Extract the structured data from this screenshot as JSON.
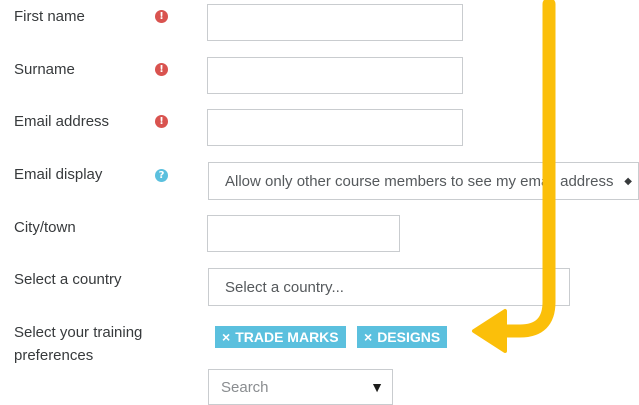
{
  "form": {
    "first_name": {
      "label": "First name",
      "value": ""
    },
    "surname": {
      "label": "Surname",
      "value": ""
    },
    "email": {
      "label": "Email address",
      "value": ""
    },
    "email_display": {
      "label": "Email display",
      "selected": "Allow only other course members to see my email address"
    },
    "city": {
      "label": "City/town",
      "value": ""
    },
    "country": {
      "label": "Select a country",
      "selected": "Select a country..."
    },
    "training": {
      "label_line1": "Select your training",
      "label_line2": "preferences",
      "tags": [
        {
          "remove": "×",
          "label": "TRADE MARKS"
        },
        {
          "remove": "×",
          "label": "DESIGNS"
        }
      ],
      "search_placeholder": "Search",
      "dropdown_caret": "▼"
    }
  },
  "icons": {
    "required": "!",
    "help": "?",
    "select_arrows": "◆"
  },
  "colors": {
    "required": "#d9534f",
    "help": "#5bc0de",
    "tag": "#5bc0de",
    "annotation_arrow": "#fbbf0a"
  }
}
